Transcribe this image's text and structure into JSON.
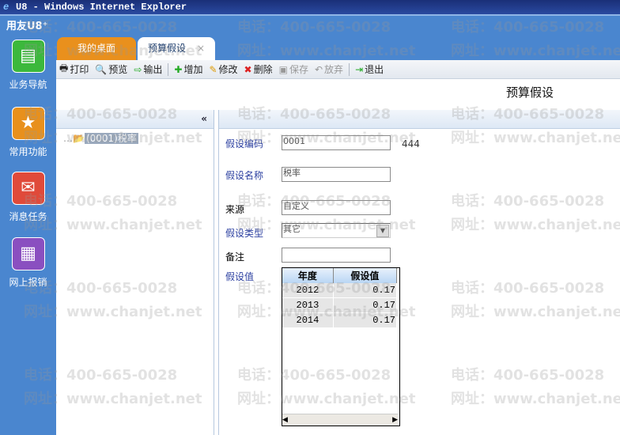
{
  "window": {
    "title": "U8 - Windows Internet Explorer"
  },
  "brand": "用友U8⁺",
  "sidebar": {
    "items": [
      {
        "label": "业务导航",
        "icon": "tree-icon",
        "color": "#3cb83c"
      },
      {
        "label": "常用功能",
        "icon": "star-icon",
        "color": "#e8901c"
      },
      {
        "label": "消息任务",
        "icon": "mail-icon",
        "color": "#e04a3a"
      },
      {
        "label": "网上报销",
        "icon": "clipboard-icon",
        "color": "#8a4fc0"
      }
    ]
  },
  "tabs": [
    {
      "label": "我的桌面"
    },
    {
      "label": "预算假设",
      "close": "×"
    }
  ],
  "toolbar": {
    "print": "打印",
    "preview": "预览",
    "export": "输出",
    "add": "增加",
    "edit": "修改",
    "delete": "删除",
    "save": "保存",
    "discard": "放弃",
    "exit": "退出"
  },
  "page_title": "预算假设",
  "left": {
    "collapse": "«",
    "tree_node": "(0001)税率"
  },
  "form": {
    "code_label": "假设编码",
    "code_value": "0001",
    "code_extra": "444",
    "name_label": "假设名称",
    "name_value": "税率",
    "source_label": "来源",
    "source_value": "自定义",
    "type_label": "假设类型",
    "type_value": "其它",
    "note_label": "备注",
    "note_value": "",
    "values_label": "假设值"
  },
  "grid": {
    "headers": [
      "年度",
      "假设值"
    ],
    "rows": [
      [
        "2012",
        "0.17"
      ],
      [
        "2013",
        "0.17"
      ],
      [
        "2014",
        "0.17"
      ]
    ]
  },
  "watermark": {
    "phone": "电话：400-665-0028",
    "site": "网址：www.chanjet.net"
  }
}
